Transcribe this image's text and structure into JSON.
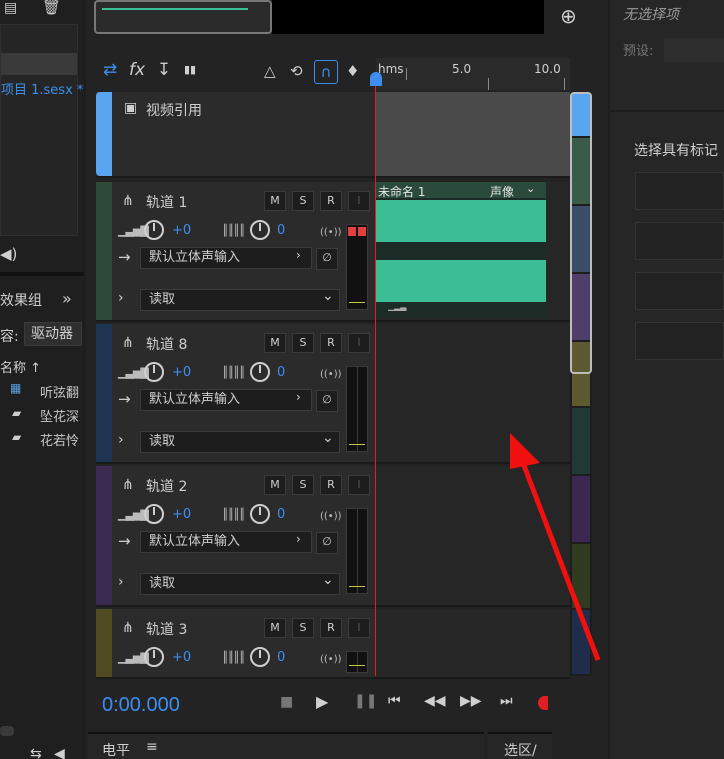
{
  "files_panel": {
    "file_name": "项目 1.sesx *"
  },
  "effects_panel": {
    "header": "效果组",
    "collapse_glyph": "»",
    "content_label": "容:",
    "content_value": "驱动器",
    "name_col": "名称 ↑",
    "items": [
      {
        "label": "听弦翻"
      },
      {
        "label": "坠花深"
      },
      {
        "label": "花若怜"
      }
    ]
  },
  "toolbar": {
    "swap": "⇄",
    "fx": "fx",
    "sort": "↧",
    "bars": "▮▮"
  },
  "timeline": {
    "ruler_labels": [
      "hms",
      "5.0",
      "10.0"
    ],
    "clip_name": "未命名 1",
    "clip_mode": "声像"
  },
  "video_track": {
    "label": "视频引用"
  },
  "tracks": [
    {
      "name": "轨道 1",
      "vol": "+0",
      "pan": "0",
      "input": "默认立体声输入",
      "mode": "读取",
      "color": "#2d4a3a"
    },
    {
      "name": "轨道 8",
      "vol": "+0",
      "pan": "0",
      "input": "默认立体声输入",
      "mode": "读取",
      "color": "#1f3352"
    },
    {
      "name": "轨道 2",
      "vol": "+0",
      "pan": "0",
      "input": "默认立体声输入",
      "mode": "读取",
      "color": "#3b2b52"
    },
    {
      "name": "轨道 3",
      "vol": "+0",
      "pan": "0",
      "input": "",
      "mode": "",
      "color": "#4f4a1f"
    }
  ],
  "track_buttons": {
    "m": "M",
    "s": "S",
    "r": "R",
    "i": "I"
  },
  "transport": {
    "time": "0:00.000"
  },
  "bottom": {
    "level_label": "电平",
    "selection_label": "选区/"
  },
  "properties": {
    "no_selection": "无选择项",
    "preset_label": "预设:",
    "select_marker": "选择具有标记"
  }
}
